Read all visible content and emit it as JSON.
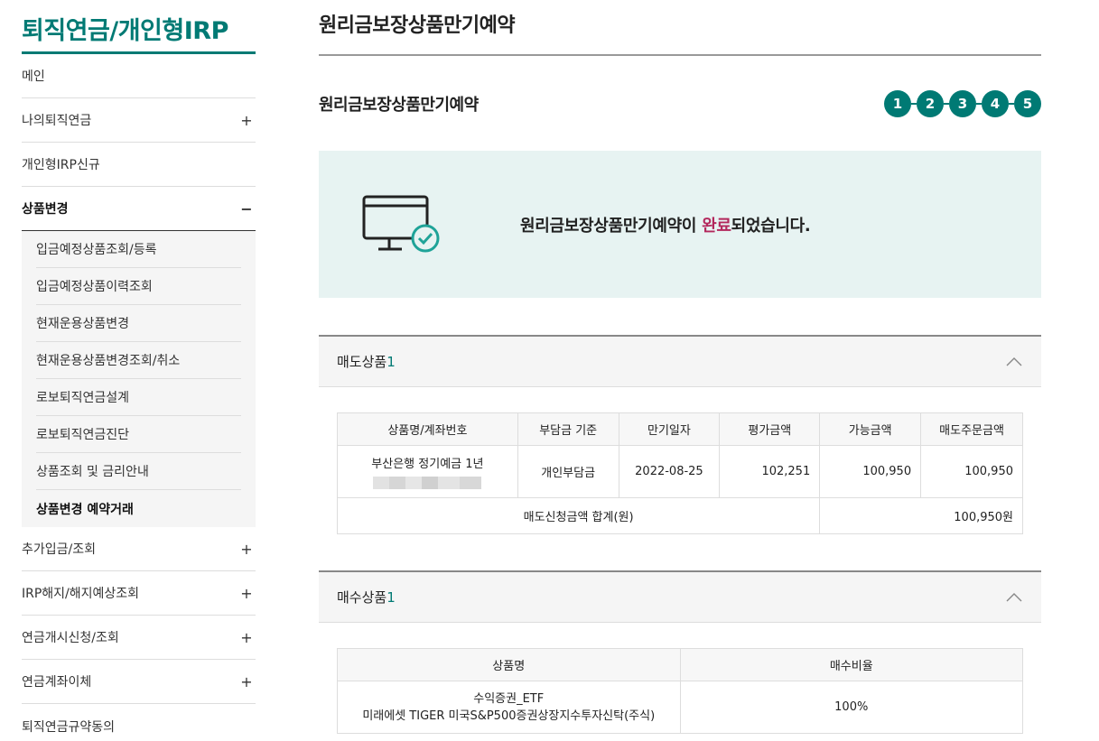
{
  "sidebar": {
    "title": "퇴직연금/개인형IRP",
    "items": [
      {
        "label": "메인",
        "sign": ""
      },
      {
        "label": "나의퇴직연금",
        "sign": "+"
      },
      {
        "label": "개인형IRP신규",
        "sign": ""
      },
      {
        "label": "상품변경",
        "sign": "−"
      }
    ],
    "submenu": [
      "입금예정상품조회/등록",
      "입금예정상품이력조회",
      "현재운용상품변경",
      "현재운용상품변경조회/취소",
      "로보퇴직연금설계",
      "로보퇴직연금진단",
      "상품조회 및 금리안내",
      "상품변경 예약거래"
    ],
    "items_after": [
      {
        "label": "추가입금/조회",
        "sign": "+"
      },
      {
        "label": "IRP해지/해지예상조회",
        "sign": "+"
      },
      {
        "label": "연금개시신청/조회",
        "sign": "+"
      },
      {
        "label": "연금계좌이체",
        "sign": "+"
      },
      {
        "label": "퇴직연금규약동의",
        "sign": ""
      }
    ]
  },
  "main": {
    "page_title": "원리금보장상품만기예약",
    "sub_title": "원리금보장상품만기예약",
    "steps": [
      "1",
      "2",
      "3",
      "4",
      "5"
    ],
    "complete": {
      "msg_before": "원리금보장상품만기예약이 ",
      "msg_highlight": "완료",
      "msg_after": "되었습니다."
    },
    "sell": {
      "label": "매도상품",
      "count": "1",
      "headers": [
        "상품명/계좌번호",
        "부담금 기준",
        "만기일자",
        "평가금액",
        "가능금액",
        "매도주문금액"
      ],
      "row": {
        "name": "부산은행 정기예금 1년",
        "basis": "개인부담금",
        "maturity": "2022-08-25",
        "eval": "102,251",
        "avail": "100,950",
        "order": "100,950"
      },
      "sum_label": "매도신청금액 합계(원)",
      "sum_value": "100,950원"
    },
    "buy": {
      "label": "매수상품",
      "count": "1",
      "headers": [
        "상품명",
        "매수비율"
      ],
      "row": {
        "name1": "수익증권_ETF",
        "name2": "미래에셋 TIGER 미국S&P500증권상장지수투자신탁(주식)",
        "ratio": "100%"
      }
    }
  },
  "colors": {
    "accent": "#007a74",
    "highlight": "#b3275c",
    "panel": "#e7f3f2"
  }
}
